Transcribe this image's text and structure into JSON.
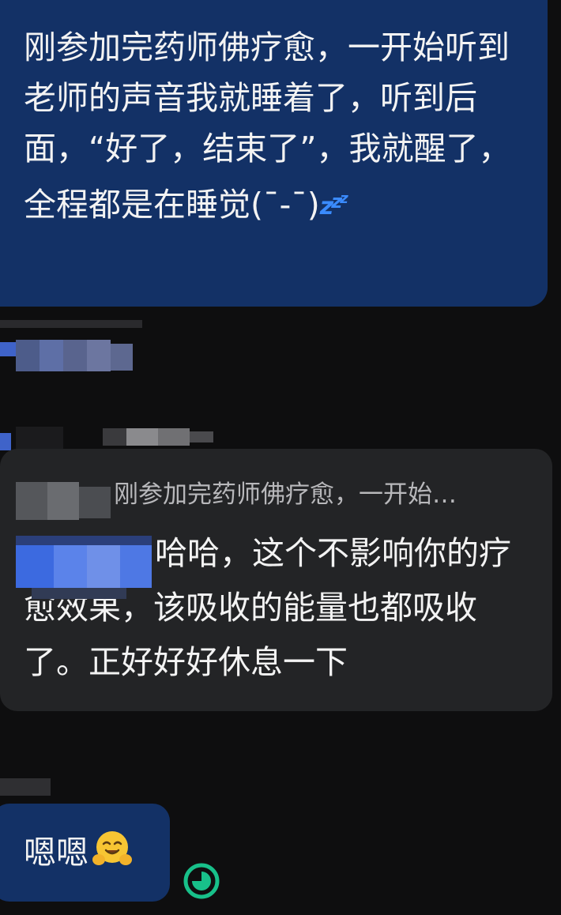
{
  "messages": {
    "sent_1": {
      "text": "刚参加完药师佛疗愈，一开始听到老师的声音我就睡着了，听到后面，“好了，结束了”，我就醒了，全程都是在睡觉(¯-¯)",
      "sticker": "zzz-sleep-icon"
    },
    "received_1": {
      "quote": "刚参加完药师佛疗愈，一开始…",
      "text": "哈哈，这个不影响你的疗愈效果，该吸收的能量也都吸收了。正好好好休息一下"
    },
    "sent_2": {
      "text": "嗯嗯",
      "emoji": "hugging-face-emoji"
    }
  },
  "status": {
    "icon": "clock-sending-icon",
    "color": "#18c08a"
  },
  "colors": {
    "background": "#0e0e0f",
    "sent_bubble": "#133166",
    "received_bubble": "#232426",
    "text": "#f3f3f3",
    "quote_text": "#b8b8bb"
  }
}
